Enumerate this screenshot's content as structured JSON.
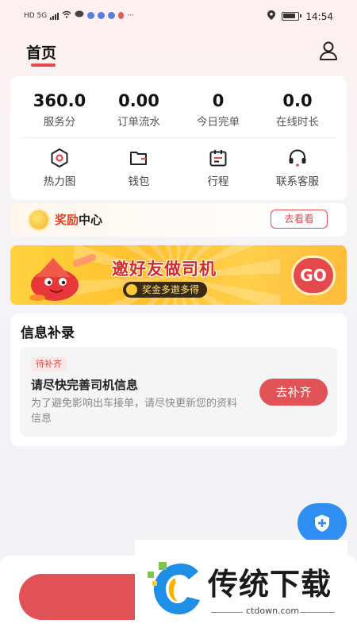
{
  "status_bar": {
    "network": "HD 5G",
    "time": "14:54",
    "more": "···"
  },
  "header": {
    "title": "首页",
    "profile_icon": "user-outline-icon"
  },
  "stats": [
    {
      "value": "360.0",
      "label": "服务分"
    },
    {
      "value": "0.00",
      "label": "订单流水"
    },
    {
      "value": "0",
      "label": "今日完单"
    },
    {
      "value": "0.0",
      "label": "在线时长"
    }
  ],
  "tools": [
    {
      "label": "热力图",
      "icon": "heatmap-icon"
    },
    {
      "label": "钱包",
      "icon": "wallet-icon"
    },
    {
      "label": "行程",
      "icon": "itinerary-icon"
    },
    {
      "label": "联系客服",
      "icon": "headset-icon"
    }
  ],
  "reward": {
    "title_highlight": "奖励",
    "title_rest": "中心",
    "button": "去看看"
  },
  "banner": {
    "title": "邀好友做司机",
    "subtitle": "奖金多邀多得",
    "go": "GO"
  },
  "info": {
    "title": "信息补录",
    "tag": "待补齐",
    "item_title": "请尽快完善司机信息",
    "item_desc": "为了避免影响出车接单，请尽快更新您的资料信息",
    "button": "去补齐"
  },
  "fab": {
    "icon": "shield-plus-icon"
  },
  "watermark": {
    "text": "传统下载",
    "url": "ctdown.com"
  },
  "colors": {
    "accent": "#e5484d",
    "fab": "#2f8ef2",
    "banner": "#ffc02e"
  }
}
